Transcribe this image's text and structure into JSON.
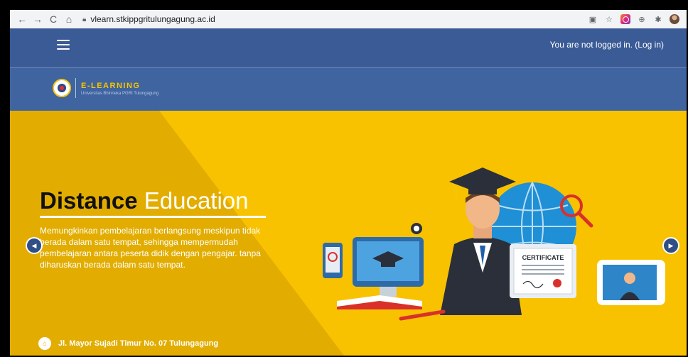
{
  "browser": {
    "url": "vlearn.stkippgritulungagung.ac.id",
    "nav_icons": [
      "back-icon",
      "forward-icon",
      "reload-icon",
      "home-icon"
    ],
    "extension_icons": [
      "translate-icon",
      "star-icon",
      "instagram-icon",
      "download-icon",
      "puzzle-icon",
      "profile-avatar"
    ]
  },
  "topbar": {
    "login_text": "You are not logged in. (Log in)"
  },
  "logo": {
    "title": "E-LEARNING",
    "subtitle": "Universitas Bhinneka PGRI Tulungagung"
  },
  "hero": {
    "title_bold": "Distance",
    "title_light": "Education",
    "description_lines": [
      "Memungkinkan pembelajaran berlangsung meskipun tidak",
      "berada dalam satu tempat, sehingga mempermudah",
      "pembelajaran antara peserta didik dengan pengajar. tanpa",
      "diharuskan berada dalam satu tempat."
    ],
    "certificate_label": "CERTIFICATE",
    "address": "Jl. Mayor Sujadi Timur No. 07 Tulungagung"
  },
  "colors": {
    "topbar": "#3a5b95",
    "logoband": "#3f649f",
    "hero_bg": "#f8c200",
    "accent": "#f7c600"
  }
}
